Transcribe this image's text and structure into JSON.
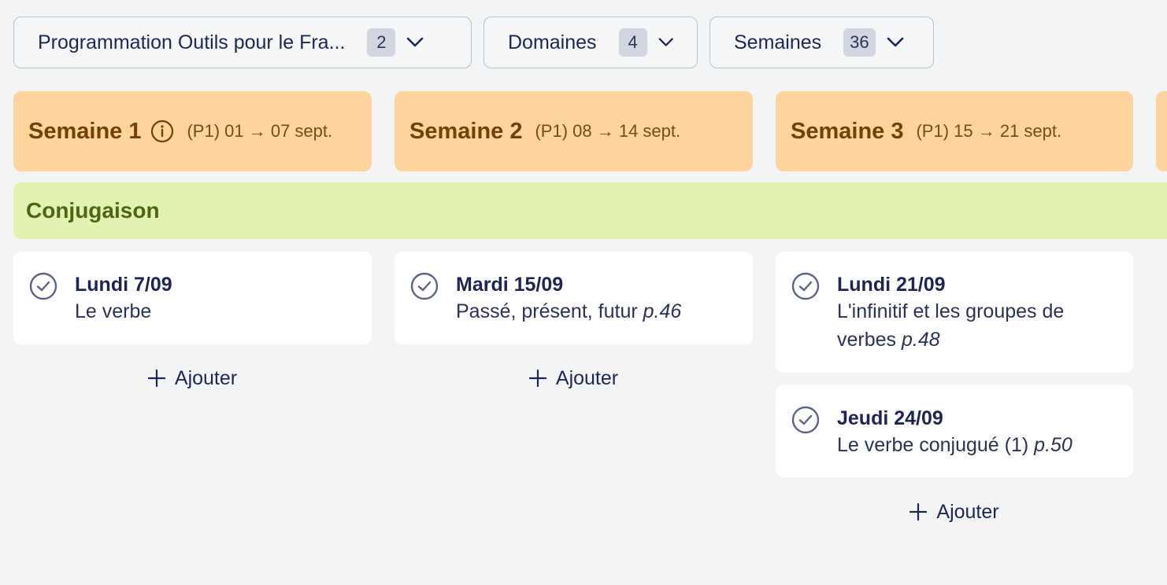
{
  "filters": [
    {
      "label": "Programmation Outils pour le Fra...",
      "count": "2"
    },
    {
      "label": "Domaines",
      "count": "4"
    },
    {
      "label": "Semaines",
      "count": "36"
    }
  ],
  "weeks": [
    {
      "title": "Semaine 1",
      "range": "(P1) 01 → 07 sept.",
      "has_info_icon": true
    },
    {
      "title": "Semaine 2",
      "range": "(P1) 08 → 14 sept."
    },
    {
      "title": "Semaine 3",
      "range": "(P1) 15 → 21 sept."
    }
  ],
  "domain": {
    "title": "Conjugaison"
  },
  "lessons": [
    {
      "date": "Lundi 7/09",
      "title": "Le verbe",
      "page": ""
    },
    {
      "date": "Mardi 15/09",
      "title": "Passé, présent, futur",
      "page": "p.46"
    },
    {
      "date": "Lundi 21/09",
      "title": "L'infinitif et les groupes de verbes",
      "page": "p.48"
    },
    {
      "date": "Jeudi 24/09",
      "title": "Le verbe conjugué (1)",
      "page": "p.50"
    }
  ],
  "add_label": "Ajouter",
  "colors": {
    "week_bg": "#fdd59c",
    "domain_bg": "#e1f2b1",
    "page_bg": "#f3f4f6"
  },
  "icons": [
    "chevron-down-icon",
    "info-icon",
    "check-circle-icon",
    "plus-icon"
  ]
}
